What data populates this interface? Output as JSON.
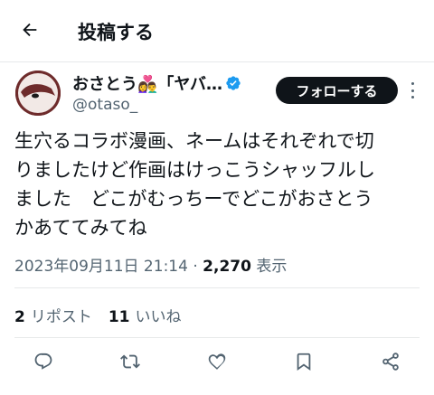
{
  "header": {
    "back_icon": "arrow-left-icon",
    "title": "投稿する"
  },
  "author": {
    "display_name": "おさとう👩‍❤️‍👨「ヤバ…",
    "handle": "@otaso_",
    "verified_icon": "verified-badge-icon",
    "follow_label": "フォローする",
    "more_icon": "more-vertical-icon"
  },
  "tweet": {
    "lines": [
      "生穴るコラボ漫画、ネームはそれぞれで切",
      "りましたけど作画はけっこうシャッフルし",
      "ました　どこがむっちーでどこがおさとう",
      "かあててみてね"
    ]
  },
  "meta": {
    "timestamp": "2023年09月11日 21:14",
    "separator": "·",
    "views": "2,270",
    "views_label": "表示"
  },
  "stats": {
    "reposts": "2",
    "reposts_label": "リポスト",
    "likes": "11",
    "likes_label": "いいね"
  },
  "actions": [
    "reply-icon",
    "repost-icon",
    "like-icon",
    "bookmark-icon",
    "share-icon"
  ],
  "colors": {
    "text": "#0f1419",
    "secondary": "#536471",
    "verified": "#1d9bf0",
    "follow_bg": "#0f1419",
    "divider": "#e7e9ea"
  }
}
